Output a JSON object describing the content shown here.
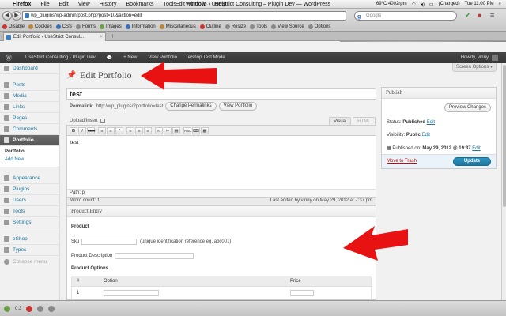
{
  "menubar": {
    "app": "Firefox",
    "items": [
      "File",
      "Edit",
      "View",
      "History",
      "Bookmarks",
      "Tools",
      "Window",
      "Help"
    ],
    "window_title": "Edit Portfolio ‹ UseStrict Consulting – Plugin Dev — WordPress",
    "temp": "69°C 4002rpm",
    "battery": "(Charged)",
    "clock": "Tue 11:00 PM"
  },
  "browser": {
    "url": "wp_plugins/wp-admin/post.php?post=10&action=edit",
    "search_placeholder": "Google",
    "tab_title": "Edit Portfolio ‹ UseStrict Consul...",
    "webdev_items": [
      "Disable",
      "Cookies",
      "CSS",
      "Forms",
      "Images",
      "Information",
      "Miscellaneous",
      "Outline",
      "Resize",
      "Tools",
      "View Source",
      "Options"
    ]
  },
  "adminbar": {
    "site": "UseStrict Consulting - Plugin Dev",
    "new": "+ New",
    "view": "View Portfolio",
    "shop": "eShop Test Mode",
    "howdy": "Howdy, vinny"
  },
  "sidebar": {
    "items": [
      {
        "label": "Dashboard"
      },
      {
        "label": "Posts"
      },
      {
        "label": "Media"
      },
      {
        "label": "Links"
      },
      {
        "label": "Pages"
      },
      {
        "label": "Comments"
      },
      {
        "label": "Portfolio"
      }
    ],
    "submenu": [
      "Portfolio",
      "Add New"
    ],
    "items2": [
      {
        "label": "Appearance"
      },
      {
        "label": "Plugins"
      },
      {
        "label": "Users"
      },
      {
        "label": "Tools"
      },
      {
        "label": "Settings"
      }
    ],
    "items3": [
      {
        "label": "eShop"
      },
      {
        "label": "Types"
      }
    ],
    "collapse": "Collapse menu"
  },
  "main": {
    "screen_options": "Screen Options ▾",
    "page_title": "Edit Portfolio",
    "post_title": "test",
    "permalink_label": "Permalink:",
    "permalink_url": "http://wp_plugins/?portfolio=test",
    "change_permalinks": "Change Permalinks",
    "view_portfolio": "View Portfolio",
    "upload_insert": "Upload/Insert",
    "tab_visual": "Visual",
    "tab_html": "HTML",
    "toolbar": [
      "B",
      "I",
      "ABC",
      "≡",
      "≡",
      "❝",
      "≡",
      "≡",
      "≡",
      "∞",
      "✂",
      "▤",
      "ABC",
      "⌨",
      "▦"
    ],
    "editor_text": "test",
    "path": "Path: p",
    "word_count": "Word count: 1",
    "last_edited": "Last edited by vinny on May 29, 2012 at 7:37 pm"
  },
  "publish": {
    "title": "Publish",
    "preview": "Preview Changes",
    "status_label": "Status:",
    "status_value": "Published",
    "visibility_label": "Visibility:",
    "visibility_value": "Public",
    "published_label": "Published on:",
    "published_value": "May 29, 2012 @ 19:37",
    "edit": "Edit",
    "trash": "Move to Trash",
    "update": "Update"
  },
  "product": {
    "title": "Product Entry",
    "section": "Product",
    "sku_label": "Sku",
    "sku_help": "(unique identification reference eg. abc001)",
    "desc_label": "Product Description",
    "options_label": "Product Options",
    "col_num": "#",
    "col_option": "Option",
    "col_price": "Price",
    "row1": "1"
  },
  "statusbar": {
    "count": "0:3"
  }
}
